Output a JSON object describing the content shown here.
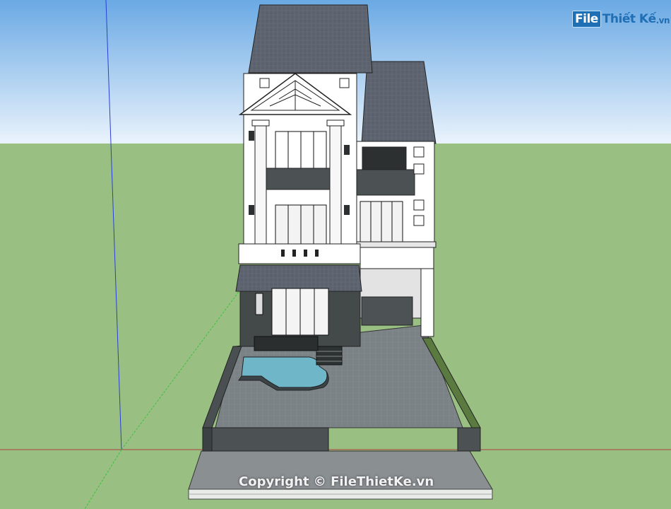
{
  "watermark": {
    "logo_box": "File",
    "logo_rest": "Thiết Kế",
    "logo_tld": ".vn"
  },
  "copyright": "Copyright © FileThietKe.vn",
  "colors": {
    "sky_top": "#7fb7e8",
    "sky_bottom": "#e9f2fb",
    "ground": "#98bf82",
    "roof": "#5d6470",
    "wall": "#ffffff",
    "dark_wall": "#4a4f4f",
    "pool": "#6fb6c8",
    "paving": "#7d8488",
    "brand": "#1f6fb5"
  },
  "icons": [
    "house-model",
    "sketchup-axis-lines"
  ]
}
